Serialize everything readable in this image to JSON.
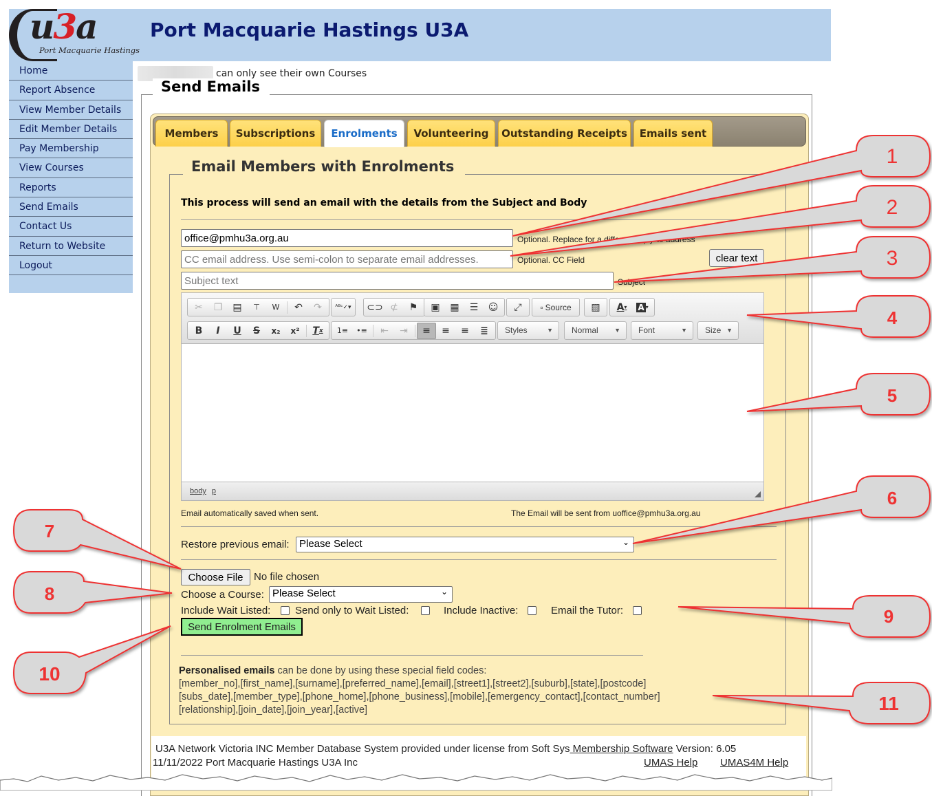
{
  "header": {
    "logo_text": "u3a",
    "logo_subtitle": "Port Macquarie Hastings",
    "site_title": "Port Macquarie Hastings U3A"
  },
  "sidebar": {
    "items": [
      {
        "label": "Home"
      },
      {
        "label": "Report Absence"
      },
      {
        "label": "View Member Details"
      },
      {
        "label": "Edit Member Details"
      },
      {
        "label": "Pay Membership"
      },
      {
        "label": "View Courses"
      },
      {
        "label": "Reports"
      },
      {
        "label": "Send Emails"
      },
      {
        "label": "Contact Us"
      },
      {
        "label": "Return to Website"
      },
      {
        "label": "Logout"
      }
    ]
  },
  "restriction_text": "can only see their own Courses",
  "page_title": "Send Emails",
  "tabs": [
    {
      "label": "Members",
      "active": false
    },
    {
      "label": "Subscriptions",
      "active": false
    },
    {
      "label": "Enrolments",
      "active": true
    },
    {
      "label": "Volunteering",
      "active": false
    },
    {
      "label": "Outstanding Receipts",
      "active": false
    },
    {
      "label": "Emails sent",
      "active": false
    }
  ],
  "form": {
    "section_title": "Email Members with Enrolments",
    "intro": "This process will send an email with the details from the Subject and Body",
    "reply_to": {
      "value": "office@pmhu3a.org.au",
      "hint": "Optional. Replace for a different reply-to address"
    },
    "cc": {
      "placeholder": "CC email address. Use semi-colon to separate email addresses.",
      "hint": "Optional. CC Field"
    },
    "clear_text_label": "clear text",
    "subject": {
      "placeholder": "Subject text",
      "hint": "Subject"
    },
    "editor": {
      "toolbar_row1": [
        {
          "icon": "cut-icon",
          "glyph": "✂",
          "disabled": true
        },
        {
          "icon": "copy-icon",
          "glyph": "⎘",
          "disabled": true
        },
        {
          "icon": "paste-icon",
          "glyph": "📋",
          "disabled": false
        },
        {
          "icon": "paste-text-icon",
          "glyph": "T",
          "disabled": false
        },
        {
          "icon": "paste-word-icon",
          "glyph": "W",
          "disabled": false
        },
        {
          "icon": "undo-icon",
          "glyph": "↶",
          "disabled": false
        },
        {
          "icon": "redo-icon",
          "glyph": "↷",
          "disabled": true
        },
        {
          "icon": "spellcheck-icon",
          "glyph": "ABC▾",
          "disabled": false
        },
        {
          "icon": "link-icon",
          "glyph": "🔗",
          "disabled": false
        },
        {
          "icon": "unlink-icon",
          "glyph": "⛓",
          "disabled": true
        },
        {
          "icon": "anchor-flag-icon",
          "glyph": "⚑",
          "disabled": false
        },
        {
          "icon": "image-icon",
          "glyph": "🖼",
          "disabled": false
        },
        {
          "icon": "table-icon",
          "glyph": "▦",
          "disabled": false
        },
        {
          "icon": "horizontal-rule-icon",
          "glyph": "☰",
          "disabled": false
        },
        {
          "icon": "smiley-icon",
          "glyph": "☺",
          "disabled": false
        },
        {
          "icon": "maximize-icon",
          "glyph": "⤢",
          "disabled": false
        },
        {
          "icon": "source-icon",
          "glyph": "Source",
          "disabled": false
        },
        {
          "icon": "image-edit-icon",
          "glyph": "🖻",
          "disabled": false
        },
        {
          "icon": "text-color-icon",
          "glyph": "A▾",
          "disabled": false
        },
        {
          "icon": "bg-color-icon",
          "glyph": "A▾",
          "disabled": false
        }
      ],
      "toolbar_row2": [
        {
          "icon": "bold-icon",
          "glyph": "B"
        },
        {
          "icon": "italic-icon",
          "glyph": "I"
        },
        {
          "icon": "underline-icon",
          "glyph": "U"
        },
        {
          "icon": "strikethrough-icon",
          "glyph": "S"
        },
        {
          "icon": "subscript-icon",
          "glyph": "x₂"
        },
        {
          "icon": "superscript-icon",
          "glyph": "x²"
        },
        {
          "icon": "remove-format-icon",
          "glyph": "Tₓ"
        },
        {
          "icon": "numbered-list-icon",
          "glyph": "⒈"
        },
        {
          "icon": "bulleted-list-icon",
          "glyph": "•≡"
        },
        {
          "icon": "outdent-icon",
          "glyph": "⇤"
        },
        {
          "icon": "indent-icon",
          "glyph": "⇥"
        },
        {
          "icon": "align-left-icon",
          "glyph": "≡"
        },
        {
          "icon": "align-center-icon",
          "glyph": "≡"
        },
        {
          "icon": "align-right-icon",
          "glyph": "≡"
        },
        {
          "icon": "justify-icon",
          "glyph": "≣"
        }
      ],
      "combos": {
        "styles": "Styles",
        "format": "Normal",
        "font": "Font",
        "size": "Size"
      },
      "path": [
        "body",
        "p"
      ],
      "body_text": ""
    },
    "autosave_note": "Email automatically saved when sent.",
    "sender_note": "The Email will be sent from uoffice@pmhu3a.org.au",
    "restore_label": "Restore previous email:",
    "restore_value": "Please Select",
    "choose_file_label": "Choose File",
    "no_file_text": "No file chosen",
    "course_label": "Choose a Course:",
    "course_value": "Please Select",
    "checkboxes": [
      {
        "label": "Include Wait Listed:",
        "checked": false
      },
      {
        "label": "Send only to Wait Listed:",
        "checked": false
      },
      {
        "label": "Include Inactive:",
        "checked": false
      },
      {
        "label": "Email the Tutor:",
        "checked": false
      }
    ],
    "send_button_label": "Send Enrolment Emails",
    "codes_bold": "Personalised emails",
    "codes_intro": " can be done by using these special field codes:",
    "codes_lines": [
      "[member_no],[first_name],[surname],[preferred_name],[email],[street1],[street2],[suburb],[state],[postcode]",
      "[subs_date],[member_type],[phone_home],[phone_business],[mobile],[emergency_contact],[contact_number]",
      "[relationship],[join_date],[join_year],[active]"
    ]
  },
  "footer": {
    "line1_prefix": "U3A Network Victoria INC Member Database System provided under license from Soft Sys",
    "line1_link": " Membership Software",
    "line1_suffix": " Version: 6.05",
    "line2": "11/11/2022 Port Macquarie Hastings U3A Inc",
    "help_link": "UMAS Help ",
    "help4m_link": "UMAS4M Help "
  },
  "callouts": [
    "1",
    "2",
    "3",
    "4",
    "5",
    "6",
    "7",
    "8",
    "9",
    "10",
    "11"
  ],
  "colors": {
    "header_bg": "#b7d1ec",
    "title_color": "#0b1a70",
    "panel_bg": "#fdeebb",
    "tab_yellow": "#fdd04a",
    "active_tab_text": "#1a6cc8",
    "send_button_bg": "#90ee90",
    "callout_fill": "#d9d9d9",
    "callout_stroke": "#ee3333"
  }
}
